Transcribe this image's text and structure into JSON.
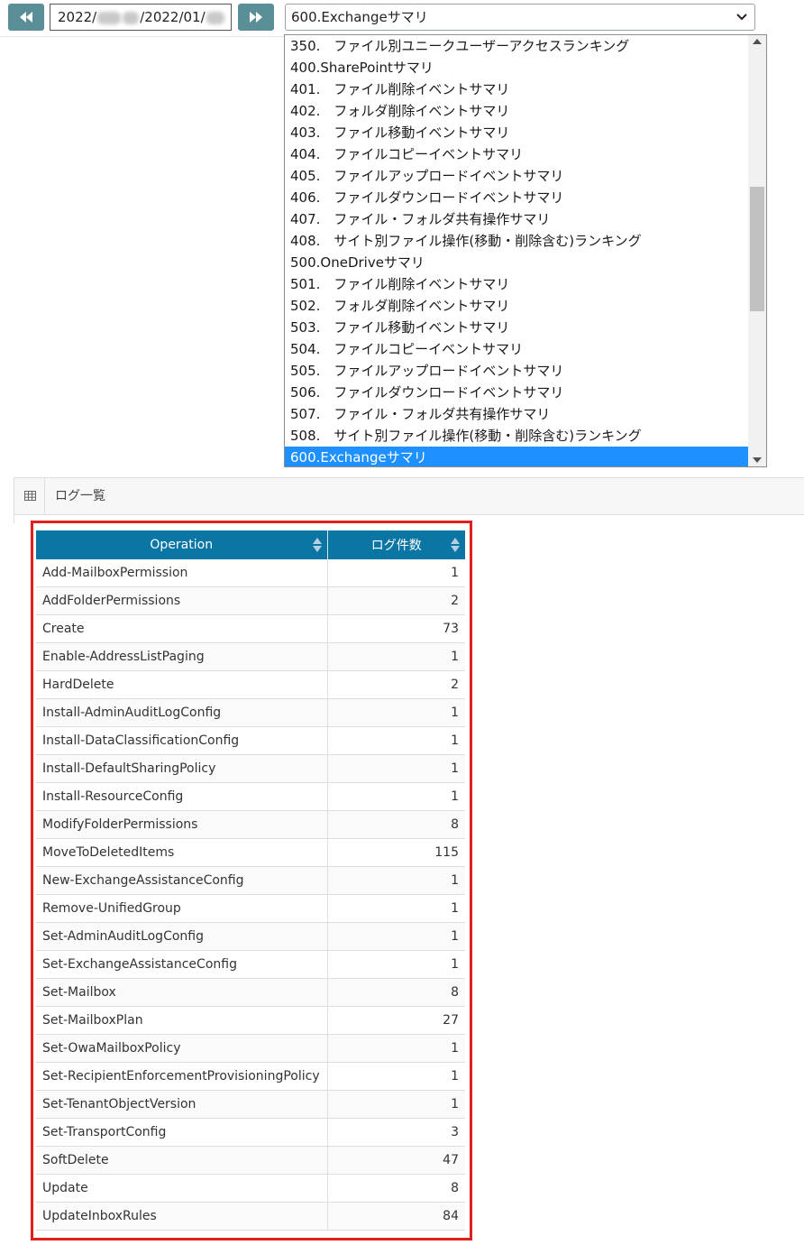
{
  "toolbar": {
    "prev_icon": "double-chevron-left-icon",
    "next_icon": "double-chevron-right-icon",
    "date_prefix": "2022/",
    "date_middle": "/2022/01/",
    "selected_report": "600.Exchangeサマリ"
  },
  "dropdown": {
    "items": [
      "350.　ファイル別ユニークユーザーアクセスランキング",
      "400.SharePointサマリ",
      "401.　ファイル削除イベントサマリ",
      "402.　フォルダ削除イベントサマリ",
      "403.　ファイル移動イベントサマリ",
      "404.　ファイルコピーイベントサマリ",
      "405.　ファイルアップロードイベントサマリ",
      "406.　ファイルダウンロードイベントサマリ",
      "407.　ファイル・フォルダ共有操作サマリ",
      "408.　サイト別ファイル操作(移動・削除含む)ランキング",
      "500.OneDriveサマリ",
      "501.　ファイル削除イベントサマリ",
      "502.　フォルダ削除イベントサマリ",
      "503.　ファイル移動イベントサマリ",
      "504.　ファイルコピーイベントサマリ",
      "505.　ファイルアップロードイベントサマリ",
      "506.　ファイルダウンロードイベントサマリ",
      "507.　ファイル・フォルダ共有操作サマリ",
      "508.　サイト別ファイル操作(移動・削除含む)ランキング",
      "600.Exchangeサマリ"
    ],
    "selected_index": 19
  },
  "panel": {
    "title": "ログ一覧",
    "icon": "table-grid-icon"
  },
  "table": {
    "headers": [
      "Operation",
      "ログ件数"
    ],
    "header_color": "#0b76a3",
    "highlight_color": "#e0201e",
    "rows": [
      [
        "Add-MailboxPermission",
        "1"
      ],
      [
        "AddFolderPermissions",
        "2"
      ],
      [
        "Create",
        "73"
      ],
      [
        "Enable-AddressListPaging",
        "1"
      ],
      [
        "HardDelete",
        "2"
      ],
      [
        "Install-AdminAuditLogConfig",
        "1"
      ],
      [
        "Install-DataClassificationConfig",
        "1"
      ],
      [
        "Install-DefaultSharingPolicy",
        "1"
      ],
      [
        "Install-ResourceConfig",
        "1"
      ],
      [
        "ModifyFolderPermissions",
        "8"
      ],
      [
        "MoveToDeletedItems",
        "115"
      ],
      [
        "New-ExchangeAssistanceConfig",
        "1"
      ],
      [
        "Remove-UnifiedGroup",
        "1"
      ],
      [
        "Set-AdminAuditLogConfig",
        "1"
      ],
      [
        "Set-ExchangeAssistanceConfig",
        "1"
      ],
      [
        "Set-Mailbox",
        "8"
      ],
      [
        "Set-MailboxPlan",
        "27"
      ],
      [
        "Set-OwaMailboxPolicy",
        "1"
      ],
      [
        "Set-RecipientEnforcementProvisioningPolicy",
        "1"
      ],
      [
        "Set-TenantObjectVersion",
        "1"
      ],
      [
        "Set-TransportConfig",
        "3"
      ],
      [
        "SoftDelete",
        "47"
      ],
      [
        "Update",
        "8"
      ],
      [
        "UpdateInboxRules",
        "84"
      ]
    ]
  }
}
